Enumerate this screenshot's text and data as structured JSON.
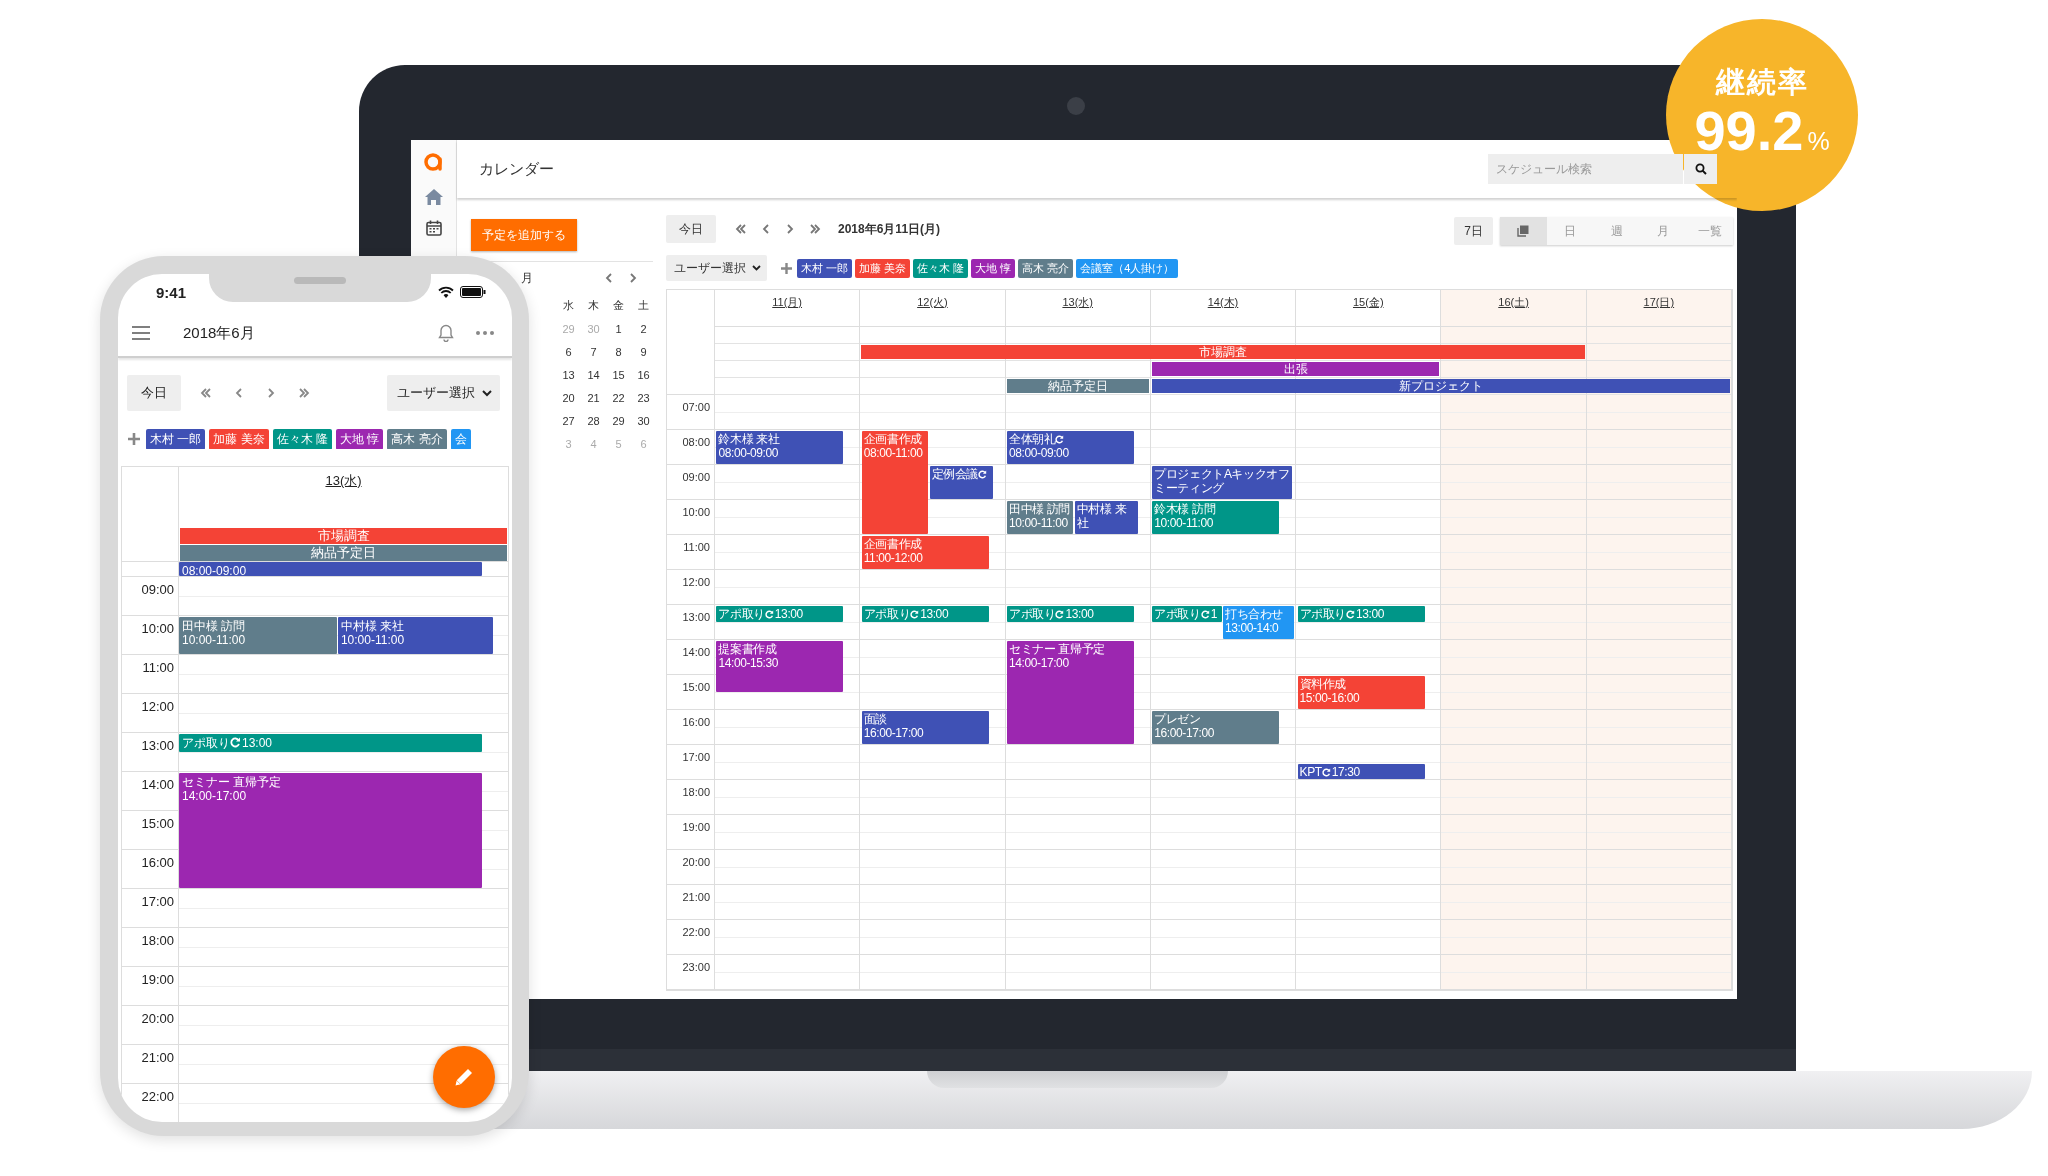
{
  "badge": {
    "label": "継続率",
    "value": "99.2",
    "unit": "%"
  },
  "laptop": {
    "title": "カレンダー",
    "search": {
      "placeholder": "スケジュール検索"
    },
    "add_button": "予定を追加する",
    "mini_calendar": {
      "month": "月",
      "weekdays": [
        "水",
        "木",
        "金",
        "土"
      ],
      "weeks": [
        [
          {
            "day": "29",
            "muted": true
          },
          {
            "day": "30",
            "muted": true
          },
          {
            "day": "1",
            "muted": false
          },
          {
            "day": "2",
            "muted": false
          }
        ],
        [
          {
            "day": "6",
            "muted": false
          },
          {
            "day": "7",
            "muted": false
          },
          {
            "day": "8",
            "muted": false
          },
          {
            "day": "9",
            "muted": false
          }
        ],
        [
          {
            "day": "13",
            "muted": false
          },
          {
            "day": "14",
            "muted": false
          },
          {
            "day": "15",
            "muted": false
          },
          {
            "day": "16",
            "muted": false
          }
        ],
        [
          {
            "day": "20",
            "muted": false
          },
          {
            "day": "21",
            "muted": false
          },
          {
            "day": "22",
            "muted": false
          },
          {
            "day": "23",
            "muted": false
          }
        ],
        [
          {
            "day": "27",
            "muted": false
          },
          {
            "day": "28",
            "muted": false
          },
          {
            "day": "29",
            "muted": false
          },
          {
            "day": "30",
            "muted": false
          }
        ],
        [
          {
            "day": "3",
            "muted": true
          },
          {
            "day": "4",
            "muted": true
          },
          {
            "day": "5",
            "muted": true
          },
          {
            "day": "6",
            "muted": true
          }
        ]
      ]
    },
    "toolbar": {
      "today": "今日",
      "date": "2018年6月11日(月)",
      "range": "7日",
      "views": [
        {
          "kind": "icon",
          "selected": true
        },
        {
          "kind": "text",
          "label": "日",
          "selected": false
        },
        {
          "kind": "text",
          "label": "週",
          "selected": false
        },
        {
          "kind": "text",
          "label": "月",
          "selected": false
        },
        {
          "kind": "text",
          "label": "一覧",
          "selected": false
        }
      ]
    },
    "user_select": "ユーザー選択",
    "users": [
      {
        "name": "木村 一郎",
        "color": "#3f51b5"
      },
      {
        "name": "加藤 美奈",
        "color": "#f44336"
      },
      {
        "name": "佐々木 隆",
        "color": "#009688"
      },
      {
        "name": "大地 惇",
        "color": "#9c27b0"
      },
      {
        "name": "高木 亮介",
        "color": "#607d8b"
      },
      {
        "name": "会議室（4人掛け）",
        "color": "#2196f3"
      }
    ],
    "calendar": {
      "days": [
        {
          "label": "11(月)",
          "weekend": false,
          "events": [
            {
              "title": "鈴木様 来社",
              "time": "08:00-09:00",
              "color": "#3f51b5",
              "recurring": false
            },
            {
              "title": "アポ取り",
              "time": "13:00",
              "color": "#009688",
              "recurring": true
            },
            {
              "title": "提案書作成",
              "time": "14:00-15:30",
              "color": "#9c27b0",
              "recurring": false
            }
          ]
        },
        {
          "label": "12(火)",
          "weekend": false,
          "events": [
            {
              "title": "企画書作成",
              "time": "08:00-11:00",
              "color": "#f44336",
              "recurring": false
            },
            {
              "title": "定例会議",
              "color": "#3f51b5",
              "recurring": true
            },
            {
              "title": "企画書作成",
              "time": "11:00-12:00",
              "color": "#f44336",
              "recurring": false
            },
            {
              "title": "アポ取り",
              "time": "13:00",
              "color": "#009688",
              "recurring": true
            },
            {
              "title": "面談",
              "time": "16:00-17:00",
              "color": "#3f51b5",
              "recurring": false
            }
          ]
        },
        {
          "label": "13(水)",
          "weekend": false,
          "events": [
            {
              "title": "全体朝礼",
              "time": "08:00-09:00",
              "color": "#3f51b5",
              "recurring": true
            },
            {
              "title": "田中様 訪問",
              "time": "10:00-11:00",
              "color": "#607d8b",
              "recurring": false
            },
            {
              "title": "中村様 来社",
              "color": "#3f51b5",
              "recurring": false
            },
            {
              "title": "アポ取り",
              "time": "13:00",
              "color": "#009688",
              "recurring": true
            },
            {
              "title": "セミナー 直帰予定",
              "time": "14:00-17:00",
              "color": "#9c27b0",
              "recurring": false
            }
          ]
        },
        {
          "label": "14(木)",
          "weekend": false,
          "events": [
            {
              "title": "プロジェクトAキックオフミーティング",
              "color": "#3f51b5",
              "recurring": false
            },
            {
              "title": "鈴木様 訪問",
              "time": "10:00-11:00",
              "color": "#009688",
              "recurring": false
            },
            {
              "title": "アポ取り",
              "time": "1",
              "color": "#009688",
              "recurring": true
            },
            {
              "title": "打ち合わせ",
              "time": "13:00-14:0",
              "color": "#2196f3",
              "recurring": false
            },
            {
              "title": "プレゼン",
              "time": "16:00-17:00",
              "color": "#607d8b",
              "recurring": false
            }
          ]
        },
        {
          "label": "15(金)",
          "weekend": false,
          "events": [
            {
              "title": "アポ取り",
              "time": "13:00",
              "color": "#009688",
              "recurring": true
            },
            {
              "title": "資料作成",
              "time": "15:00-16:00",
              "color": "#f44336",
              "recurring": false
            },
            {
              "title": "KPT",
              "time": "17:30",
              "color": "#3f51b5",
              "recurring": true
            }
          ]
        },
        {
          "label": "16(土)",
          "weekend": true
        },
        {
          "label": "17(日)",
          "weekend": true
        }
      ],
      "all_day": [
        {
          "bars": [
            {
              "title": "市場調査",
              "color": "#f44336"
            }
          ]
        },
        {
          "bars": [
            {
              "title": "出張",
              "color": "#9c27b0"
            }
          ]
        },
        {
          "bars": [
            {
              "title": "納品予定日",
              "color": "#607d8b"
            },
            {
              "title": "新プロジェクト",
              "color": "#3f51b5"
            }
          ]
        }
      ],
      "hours": [
        "07:00",
        "08:00",
        "09:00",
        "10:00",
        "11:00",
        "12:00",
        "13:00",
        "14:00",
        "15:00",
        "16:00",
        "17:00",
        "18:00",
        "19:00",
        "20:00",
        "21:00",
        "22:00",
        "23:00"
      ]
    }
  },
  "phone": {
    "time": "9:41",
    "title": "2018年6月",
    "today": "今日",
    "user_select": "ユーザー選択",
    "users": [
      {
        "name": "木村 一郎",
        "color": "#3f51b5"
      },
      {
        "name": "加藤 美奈",
        "color": "#f44336"
      },
      {
        "name": "佐々木 隆",
        "color": "#009688"
      },
      {
        "name": "大地 惇",
        "color": "#9c27b0"
      },
      {
        "name": "高木 亮介",
        "color": "#607d8b"
      },
      {
        "name": "会",
        "color": "#2196f3"
      }
    ],
    "day": "13(水)",
    "all_day": [
      {
        "title": "市場調査",
        "color": "#f44336"
      },
      {
        "title": "納品予定日",
        "color": "#607d8b"
      }
    ],
    "hours": [
      "09:00",
      "10:00",
      "11:00",
      "12:00",
      "13:00",
      "14:00",
      "15:00",
      "16:00",
      "17:00",
      "18:00",
      "19:00",
      "20:00",
      "21:00",
      "22:00"
    ],
    "events": [
      {
        "time": "08:00-09:00",
        "color": "#3f51b5",
        "recurring": false
      },
      {
        "title": "田中様 訪問",
        "time": "10:00-11:00",
        "color": "#607d8b",
        "recurring": false
      },
      {
        "title": "中村様 来社",
        "time": "10:00-11:00",
        "color": "#3f51b5",
        "recurring": false
      },
      {
        "title": "アポ取り",
        "time": "13:00",
        "color": "#009688",
        "recurring": true
      },
      {
        "title": "セミナー 直帰予定",
        "time": "14:00-17:00",
        "color": "#9c27b0",
        "recurring": false
      }
    ]
  }
}
